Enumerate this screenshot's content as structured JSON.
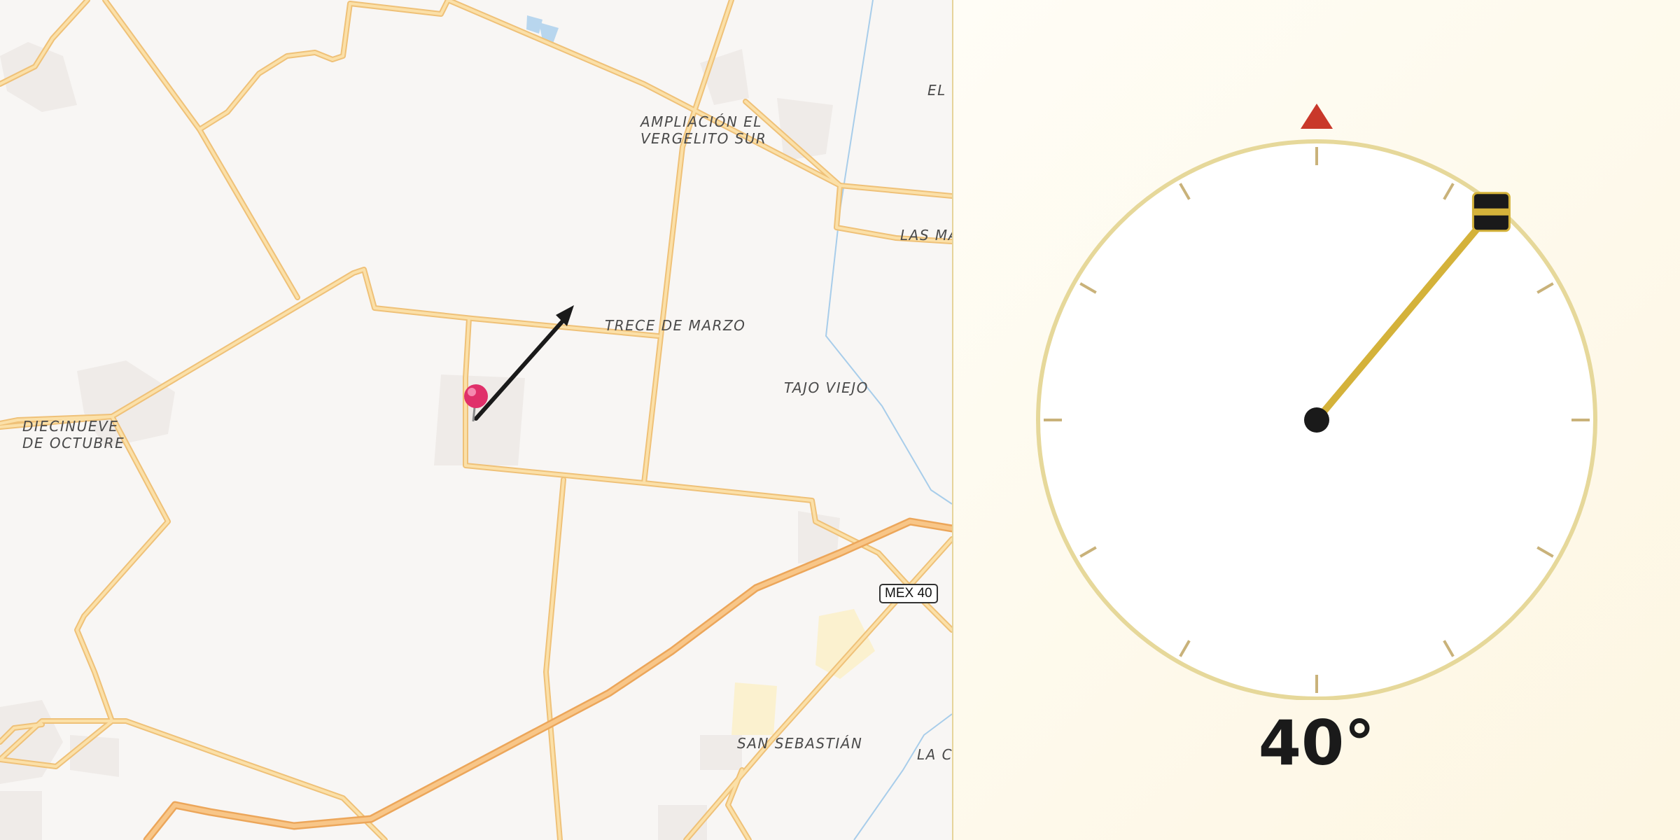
{
  "map": {
    "places": [
      {
        "id": "ampliacion",
        "text": "AMPLIACIÓN EL\nVERGELITO SUR"
      },
      {
        "id": "trece",
        "text": "TRECE DE MARZO"
      },
      {
        "id": "tajo",
        "text": "TAJO VIEJO"
      },
      {
        "id": "diecinueve",
        "text": "DIECINUEVE\nDE OCTUBRE"
      },
      {
        "id": "sebastian",
        "text": "SAN SEBASTIÁN"
      },
      {
        "id": "el",
        "text": "EL"
      },
      {
        "id": "lasma",
        "text": "LAS MA"
      },
      {
        "id": "lac",
        "text": "LA C"
      }
    ],
    "highway_shield": "MEX 40",
    "pin_icon": "map-pin-icon",
    "arrow_icon": "direction-arrow-icon",
    "colors": {
      "road": "#f7cf86",
      "highway": "#f6b96a",
      "water": "#a8cdea",
      "background": "#f8f6f4"
    }
  },
  "compass": {
    "heading_degrees": 40,
    "heading_text": "40°",
    "north_marker_icon": "north-triangle-icon",
    "needle_icon": "heading-needle-icon",
    "colors": {
      "ring": "#e6d89a",
      "needle": "#d4b23a",
      "north": "#c9382a",
      "hub": "#1a1a1a"
    }
  }
}
